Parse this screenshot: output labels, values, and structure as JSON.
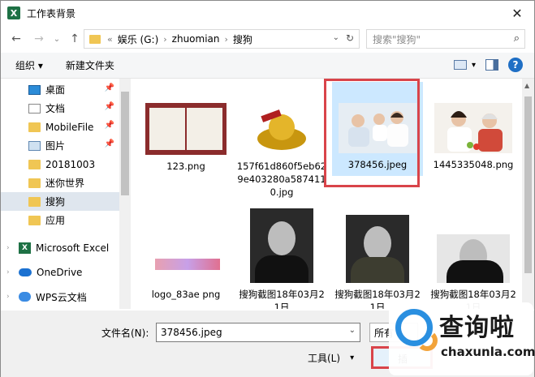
{
  "window": {
    "title": "工作表背景",
    "close": "✕"
  },
  "nav": {
    "back": "←",
    "forward": "→",
    "recent": "⌄",
    "up": "↑"
  },
  "address": {
    "prefix": "«",
    "crumbs": [
      "娱乐 (G:)",
      "zhuomian",
      "搜狗"
    ],
    "separator": "›",
    "dropdown": "⌄",
    "refresh": "↻"
  },
  "search": {
    "placeholder": "搜索\"搜狗\"",
    "icon": "⌕"
  },
  "toolbar": {
    "organize": "组织 ▾",
    "new_folder": "新建文件夹",
    "view_arrow": "▾",
    "help": "?"
  },
  "sidebar": {
    "quick": [
      {
        "label": "桌面",
        "icon": "desktop",
        "pinned": true
      },
      {
        "label": "文档",
        "icon": "document",
        "pinned": true
      },
      {
        "label": "MobileFile",
        "icon": "folder",
        "pinned": true
      },
      {
        "label": "图片",
        "icon": "pictures",
        "pinned": true
      },
      {
        "label": "20181003",
        "icon": "folder",
        "pinned": false
      },
      {
        "label": "迷你世界",
        "icon": "folder",
        "pinned": false
      },
      {
        "label": "搜狗",
        "icon": "folder",
        "pinned": false,
        "selected": true
      },
      {
        "label": "应用",
        "icon": "folder",
        "pinned": false
      }
    ],
    "pin_glyph": "📌",
    "top": [
      {
        "label": "Microsoft Excel",
        "icon": "excel"
      },
      {
        "label": "OneDrive",
        "icon": "onedrive"
      },
      {
        "label": "WPS云文档",
        "icon": "wps-cloud"
      }
    ],
    "expand": "›"
  },
  "files": [
    {
      "name": "123.png",
      "thumb": "certificate"
    },
    {
      "name": "157f61d860f5eb629e403280a5874110.jpg",
      "thumb": "gold-ingot"
    },
    {
      "name": "378456.jpeg",
      "thumb": "doctor-patient",
      "selected": true
    },
    {
      "name": "1445335048.png",
      "thumb": "doctor-patient"
    },
    {
      "name": "logo_83ae   png",
      "thumb": "logo"
    },
    {
      "name": "搜狗截图18年03月21日",
      "thumb": "portrait"
    },
    {
      "name": "搜狗截图18年03月21日",
      "thumb": "portrait"
    },
    {
      "name": "搜狗截图18年03月21日",
      "thumb": "portrait"
    }
  ],
  "bottom": {
    "filename_label": "文件名(N):",
    "filename_value": "378456.jpeg",
    "filetype": "所有",
    "tools": "工具(L)",
    "tools_arrow": "▾",
    "open": "插"
  },
  "watermark": {
    "brand": "查询啦",
    "domain": "chaxunla.com"
  },
  "colors": {
    "selection": "#cce8ff",
    "highlight": "#d9444a",
    "sidebar_sel": "#dfe6ee",
    "accent": "#0078d7"
  }
}
